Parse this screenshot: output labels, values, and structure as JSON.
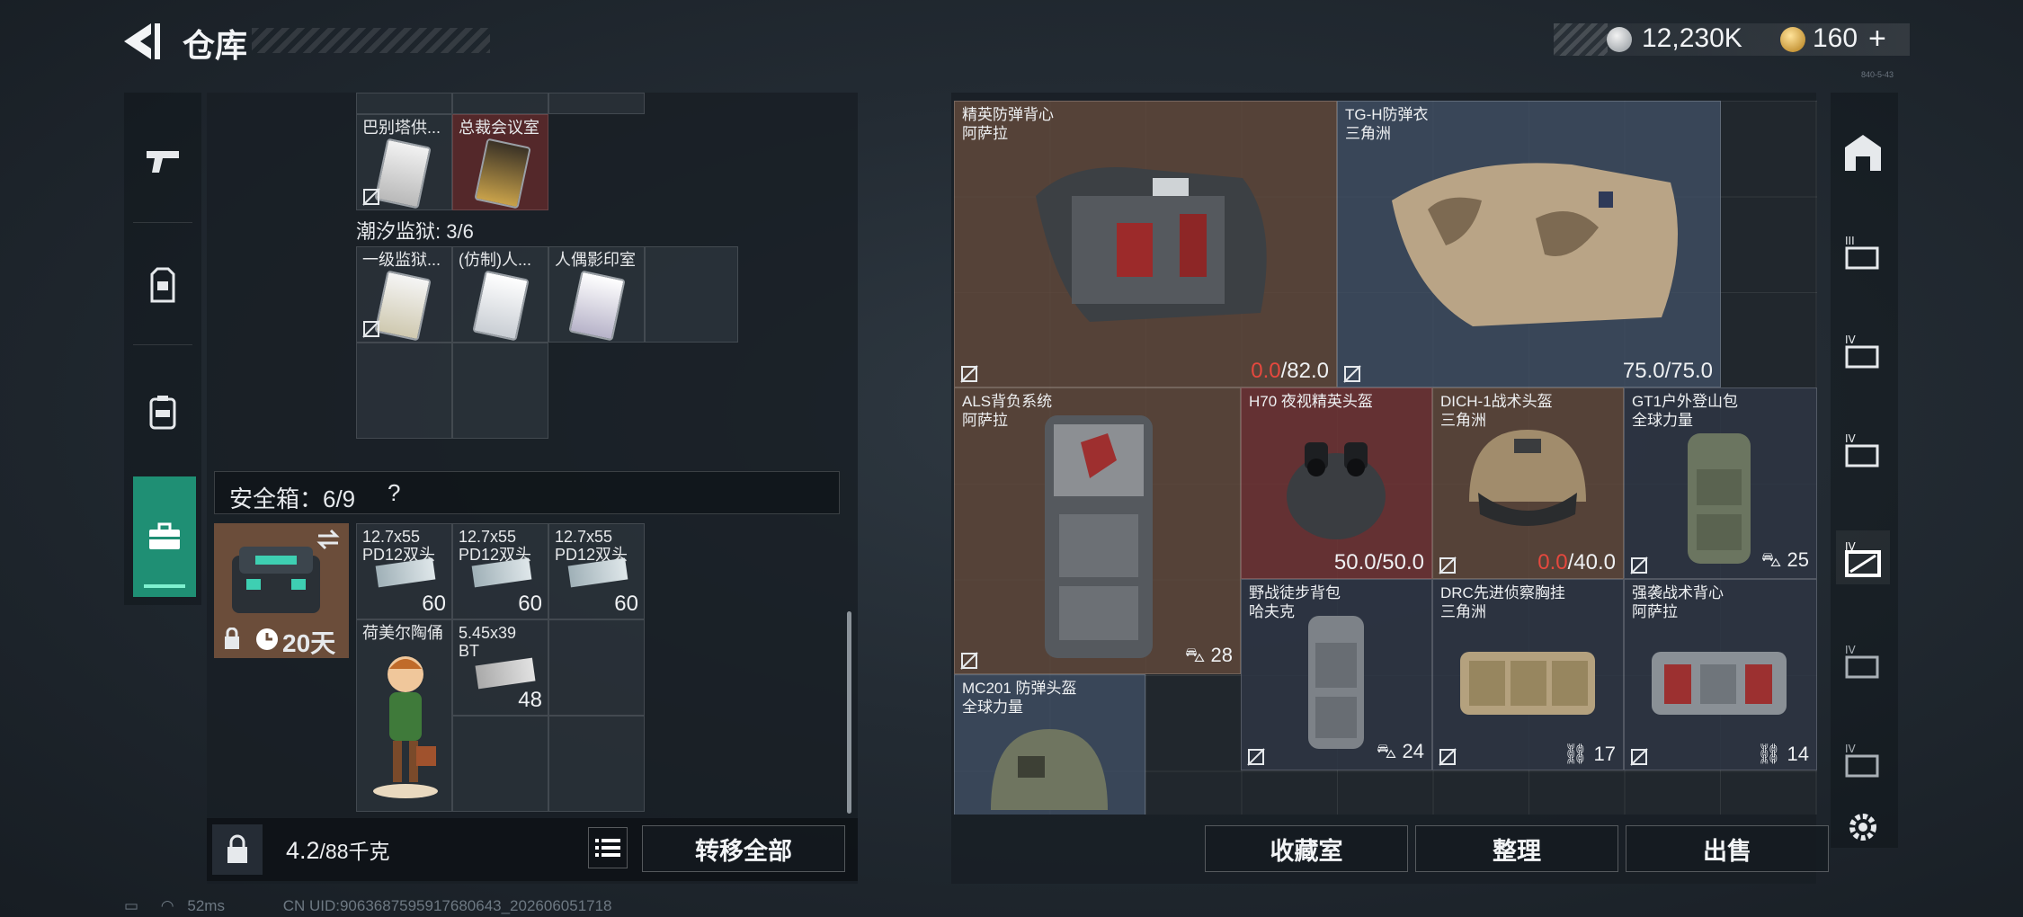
{
  "header": {
    "title": "仓库",
    "silver_amount": "12,230K",
    "gold_amount": "160",
    "gold_plus": "+",
    "version_tiny": "840-5-43"
  },
  "left": {
    "row1_labels": [
      "巴别塔供...",
      "总裁会议室"
    ],
    "prison_section": "潮汐监狱: 3/6",
    "prison_labels": [
      "一级监狱...",
      "(仿制)人...",
      "人偶影印室"
    ],
    "safe_header": "安全箱：6/9",
    "safe_help": "?",
    "safe_timer": "20天",
    "safe_items": [
      {
        "label": "12.7x55\nPD12双头",
        "qty": "60"
      },
      {
        "label": "12.7x55\nPD12双头",
        "qty": "60"
      },
      {
        "label": "12.7x55\nPD12双头",
        "qty": "60"
      },
      {
        "label": "荷美尔陶俑",
        "qty": ""
      },
      {
        "label": "5.45x39\nBT",
        "qty": "48"
      }
    ],
    "weight_value": "4.2",
    "weight_unit": "/88千克",
    "transfer_all": "转移全部"
  },
  "right": {
    "items": [
      {
        "name": "精英防弹背心",
        "sub": "阿萨拉",
        "dur_cur": "0.0",
        "dur_max": "/82.0"
      },
      {
        "name": "TG-H防弹衣",
        "sub": "三角洲",
        "dur_cur": "75.0",
        "dur_max": "/75.0"
      },
      {
        "name": "ALS背负系统",
        "sub": "阿萨拉",
        "count": "28"
      },
      {
        "name": "H70 夜视精英头盔",
        "sub": "",
        "dur_cur": "50.0",
        "dur_max": "/50.0"
      },
      {
        "name": "DICH-1战术头盔",
        "sub": "三角洲",
        "dur_cur": "0.0",
        "dur_max": "/40.0"
      },
      {
        "name": "GT1户外登山包",
        "sub": "全球力量",
        "count": "25"
      },
      {
        "name": "野战徒步背包",
        "sub": "哈夫克",
        "count": "24"
      },
      {
        "name": "DRC先进侦察胸挂",
        "sub": "三角洲",
        "count": "17"
      },
      {
        "name": "强袭战术背心",
        "sub": "阿萨拉",
        "count": "14"
      },
      {
        "name": "MC201 防弹头盔",
        "sub": "全球力量",
        "count": ""
      }
    ],
    "buttons": {
      "collection": "收藏室",
      "sort": "整理",
      "sell": "出售"
    }
  },
  "status": {
    "ping": "52ms",
    "uid": "CN UID:9063687595917680643_202606051718"
  },
  "colors": {
    "accent": "#1f8f74",
    "danger": "#e5483e",
    "rare_red": "#6e2c2c",
    "rare_brown": "#604838",
    "rare_blue": "#405064"
  }
}
